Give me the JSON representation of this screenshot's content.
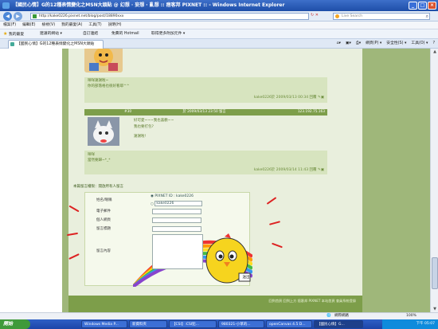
{
  "window": {
    "title": "【國民心情】G的12種表情變化之MSN大頭貼 @ 幻想 · 妄想 · 亂想 :: 痞客邦 PIXNET :: - Windows Internet Explorer"
  },
  "address": {
    "url": "http://kake0226.pixnet.net/blog/post/18890xxx",
    "search_placeholder": "Live Search"
  },
  "menu": [
    "檔案(F)",
    "編輯(E)",
    "檢視(V)",
    "我的最愛(A)",
    "工具(T)",
    "說明(H)"
  ],
  "favbar": {
    "favorites": "我的最愛",
    "item1": "建議的網站 ▾",
    "item2": "自訂連結",
    "item3": "免費的 Hotmail",
    "item4": "取得更多附加元件 ▾"
  },
  "tab": {
    "label": "【國民心情】G的12種表情變化之MSN大頭貼"
  },
  "toolbar": {
    "page": "網頁(P) ▾",
    "safety": "安全性(S) ▾",
    "tools": "工具(O) ▾",
    "help": "?"
  },
  "comments": [
    {
      "text1": "咩咩謝謝啦~",
      "text2": "你的部落格也很好看耶^^",
      "meta": "kake0226於 2009/03/13 00:34 回覆"
    },
    {
      "header": "#30　　　　　　　　　　　　　　　於 2009/03/13 23:50 留言",
      "ip": "123.192.75.163",
      "text1": "好可愛~~~我也喜歡~~",
      "text2": "我也要打包?",
      "text3": "謝謝啦!",
      "text4": "咩咩",
      "text5": "當然要歸~*_*",
      "meta": "kake0226於 2009/03/14 11:43 回覆"
    }
  ],
  "form": {
    "notice": "本篇留言權限：開放所有人留言",
    "name_label": "姓名/暱稱",
    "email_label": "電子郵件",
    "site_label": "個人網頁",
    "subject_label": "留言標題",
    "content_label": "留言內容",
    "pixnet_id": "PIXNET ID : kake0226",
    "name_value": "kake0226",
    "submit": "送出"
  },
  "footer": {
    "text": "回到首頁 回到上方 痞客邦 PIXNET 本站首頁 會員系統登錄"
  },
  "status": {
    "zone": "網際網路",
    "zoom": "100%"
  },
  "taskbar": {
    "start": "開始",
    "items": [
      "Windows Media P...",
      "新資料夾",
      "【CSI】:CSI犯...",
      "980321-小草的...",
      "openCanvas 4.5 D...",
      "【國民心情】G..."
    ],
    "clock": "下午 05:07"
  },
  "colors": {
    "green_bg": "#e9efdd",
    "green_side": "#9fb77a",
    "comment_bg": "#d7e4bf",
    "footer": "#7d9e4a"
  }
}
